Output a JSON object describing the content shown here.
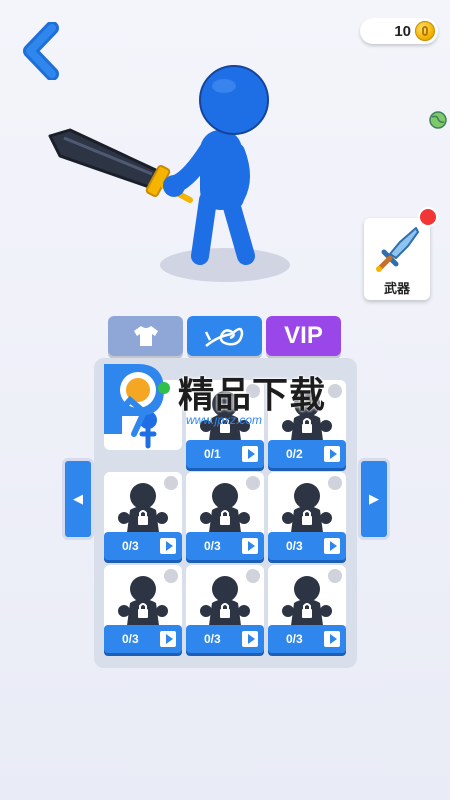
{
  "header": {
    "coins": "10",
    "coin_icon": "coin-icon",
    "back_icon": "back-arrow-icon"
  },
  "weapon": {
    "label": "武器",
    "icon": "sword-icon",
    "badge_color": "#f23535"
  },
  "tabs": [
    {
      "name": "outfit",
      "icon": "shirt-icon"
    },
    {
      "name": "symbol",
      "icon": "swirl-leaf-icon"
    },
    {
      "name": "vip",
      "label": "VIP"
    }
  ],
  "grid": [
    {
      "count": "",
      "state": "selected"
    },
    {
      "count": "0/1",
      "state": "locked"
    },
    {
      "count": "0/2",
      "state": "locked"
    },
    {
      "count": "0/3",
      "state": "locked"
    },
    {
      "count": "0/3",
      "state": "locked"
    },
    {
      "count": "0/3",
      "state": "locked"
    },
    {
      "count": "0/3",
      "state": "locked"
    },
    {
      "count": "0/3",
      "state": "locked"
    },
    {
      "count": "0/3",
      "state": "locked"
    }
  ],
  "nav": {
    "prev": "◀",
    "next": "▶"
  },
  "watermark": {
    "title": "精品下载",
    "url": "www.jpxz.com"
  },
  "colors": {
    "primary": "#2f87ee",
    "vip": "#9a47e9",
    "outfit_tab": "#8fa7d6",
    "hero": "#1e6fe6"
  }
}
